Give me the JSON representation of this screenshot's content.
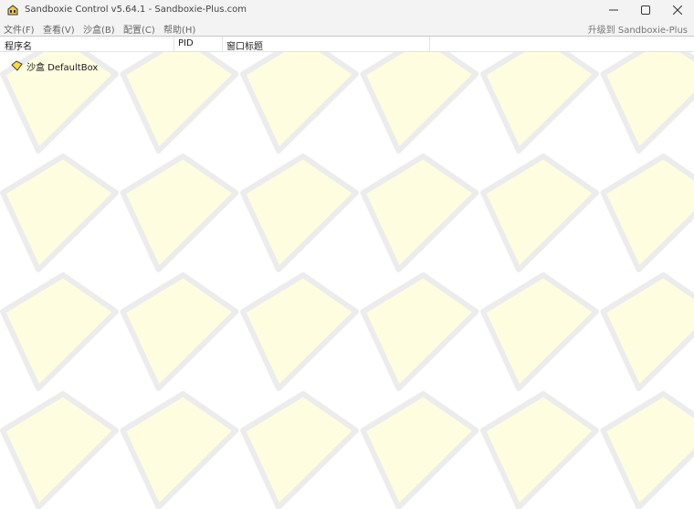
{
  "window": {
    "title": "Sandboxie Control v5.64.1 - Sandboxie-Plus.com",
    "icon": "sandboxie-app-icon",
    "controls": {
      "minimize": "minimize-icon",
      "maximize": "maximize-icon",
      "close": "close-icon"
    }
  },
  "menu": {
    "items": [
      "文件(F)",
      "查看(V)",
      "沙盒(B)",
      "配置(C)",
      "帮助(H)"
    ],
    "upgrade": "升级到 Sandboxie-Plus"
  },
  "table": {
    "columns": [
      "程序名",
      "PID",
      "窗口标题"
    ]
  },
  "tree": {
    "boxes": [
      {
        "label": "沙盒 DefaultBox",
        "icon": "sandbox-diamond-icon"
      }
    ]
  },
  "colors": {
    "pattern_fill": "#fffde0",
    "pattern_stroke": "#ececec",
    "box_icon": "#f5d94a"
  }
}
